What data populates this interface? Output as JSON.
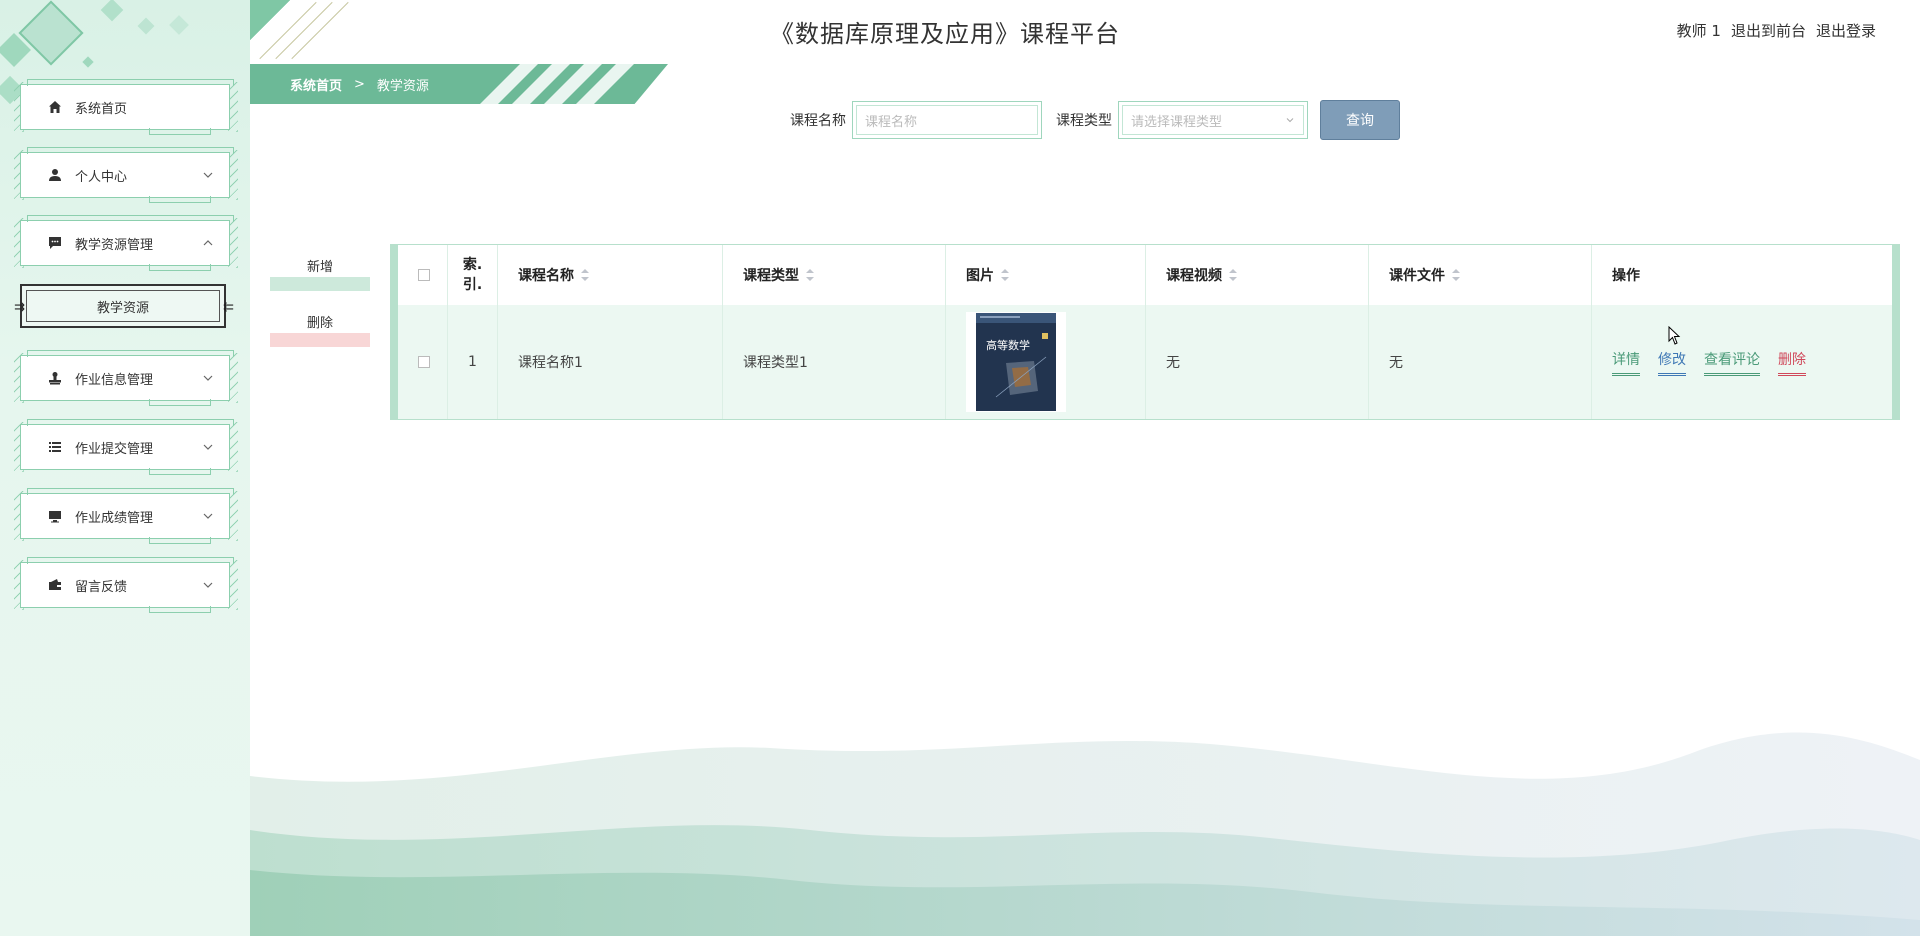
{
  "title": "《数据库原理及应用》课程平台",
  "user": {
    "name": "教师 1",
    "front_link": "退出到前台",
    "logout_link": "退出登录"
  },
  "breadcrumb": {
    "home": "系统首页",
    "separator": ">",
    "current": "教学资源"
  },
  "sidebar": {
    "items": [
      {
        "label": "系统首页",
        "icon": "home-icon",
        "has_children": false
      },
      {
        "label": "个人中心",
        "icon": "user-icon",
        "has_children": true,
        "expanded": false
      },
      {
        "label": "教学资源管理",
        "icon": "message-icon",
        "has_children": true,
        "expanded": true
      },
      {
        "label": "作业信息管理",
        "icon": "stamp-icon",
        "has_children": true,
        "expanded": false
      },
      {
        "label": "作业提交管理",
        "icon": "list-icon",
        "has_children": true,
        "expanded": false
      },
      {
        "label": "作业成绩管理",
        "icon": "monitor-icon",
        "has_children": true,
        "expanded": false
      },
      {
        "label": "留言反馈",
        "icon": "wallet-icon",
        "has_children": true,
        "expanded": false
      }
    ],
    "subitem": {
      "label": "教学资源"
    }
  },
  "search": {
    "name_label": "课程名称",
    "name_placeholder": "课程名称",
    "type_label": "课程类型",
    "type_placeholder": "请选择课程类型",
    "query_button": "查询"
  },
  "actions": {
    "add": "新增",
    "delete": "删除"
  },
  "table": {
    "columns": [
      "",
      "索.引.",
      "课程名称",
      "课程类型",
      "图片",
      "课程视频",
      "课件文件",
      "操作"
    ],
    "index_header_lines": [
      "索.",
      "引."
    ],
    "rows": [
      {
        "index": "1",
        "name": "课程名称1",
        "type": "课程类型1",
        "image_alt": "高等数学",
        "video": "无",
        "file": "无"
      }
    ],
    "operations": [
      "详情",
      "修改",
      "查看评论",
      "删除"
    ]
  },
  "colors": {
    "accent": "#6cb997",
    "sidebar_bg": "#e6f6ee",
    "query_button": "#7f9db8",
    "delete_link": "#d0485a",
    "edit_link": "#3f78b5"
  }
}
